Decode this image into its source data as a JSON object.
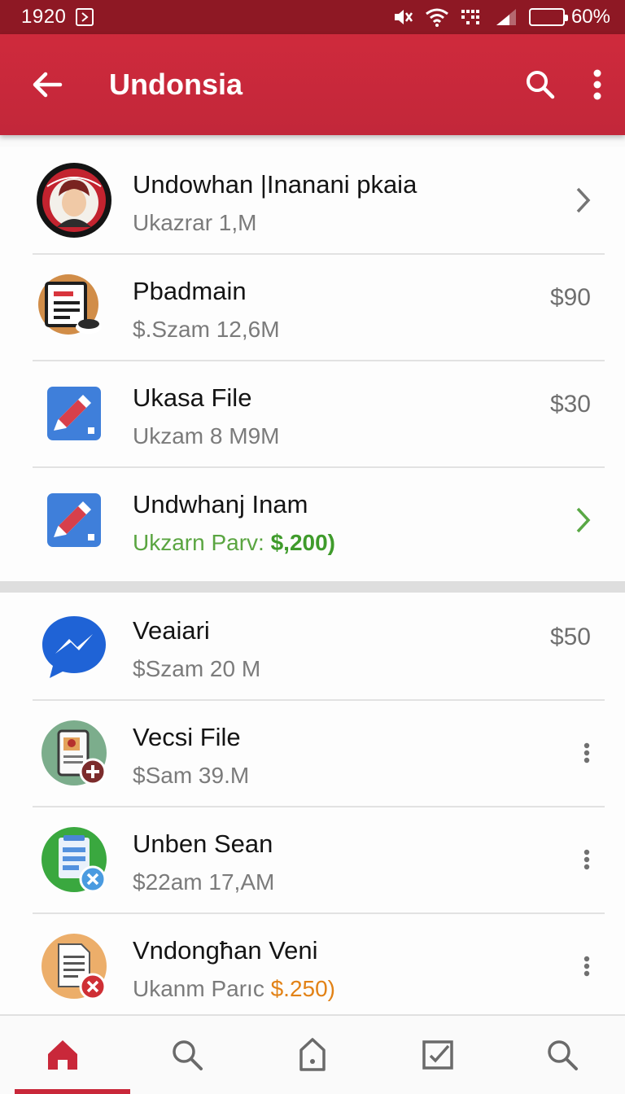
{
  "status_bar": {
    "time": "1920",
    "battery_percent": "60%",
    "battery_level": 0.6
  },
  "app_bar": {
    "title": "Undonsia",
    "back_icon": "arrow-left-icon",
    "search_icon": "search-icon",
    "menu_icon": "more-vert-icon"
  },
  "list_a": [
    {
      "title": "Undowhan |Inanani pkaia",
      "subtitle": "Ukazrar 1,M",
      "trailing": "",
      "trailing_icon": "chevron-right-icon",
      "avatar": "profile-portrait-icon"
    },
    {
      "title": "Pbadmain",
      "subtitle": "$.Szam 12,6M",
      "trailing": "$90",
      "avatar": "clipboard-document-icon"
    },
    {
      "title": "Ukasa File",
      "subtitle": "Ukzam 8 M9M",
      "trailing": "$30",
      "avatar": "pen-file-icon"
    },
    {
      "title": "Undwhanj Inam",
      "subtitle_prefix": "Ukzarn Parv: ",
      "subtitle_highlight": "$,200)",
      "trailing": "",
      "trailing_icon": "chevron-right-icon",
      "avatar": "pen-file-icon"
    }
  ],
  "list_b": [
    {
      "title": "Veaiari",
      "subtitle": "$Szam 20 M",
      "trailing": "$50",
      "avatar": "messenger-icon"
    },
    {
      "title": "Vecsi File",
      "subtitle": "$Sam 39.M",
      "trailing": "",
      "trailing_icon": "more-vert-icon",
      "avatar": "phone-add-icon"
    },
    {
      "title": "Unben Sean",
      "subtitle": "$22am 17,AM",
      "trailing": "",
      "trailing_icon": "more-vert-icon",
      "avatar": "notes-cancel-icon"
    },
    {
      "title": "Vndongħan Veni",
      "subtitle_prefix": "Ukanm Parıc ",
      "subtitle_highlight": "$.250)",
      "trailing": "",
      "trailing_icon": "more-vert-icon",
      "avatar": "document-delete-icon"
    }
  ],
  "bottom_nav": [
    {
      "name": "home",
      "icon": "home-icon",
      "active": true
    },
    {
      "name": "search",
      "icon": "search-icon",
      "active": false
    },
    {
      "name": "document",
      "icon": "document-icon",
      "active": false
    },
    {
      "name": "checkbox",
      "icon": "check-square-icon",
      "active": false
    },
    {
      "name": "search-2",
      "icon": "search-icon",
      "active": false
    }
  ],
  "colors": {
    "status_bar": "#8e1824",
    "app_bar": "#c9283a",
    "accent_green": "#3f9b2b",
    "accent_orange": "#e28216"
  }
}
